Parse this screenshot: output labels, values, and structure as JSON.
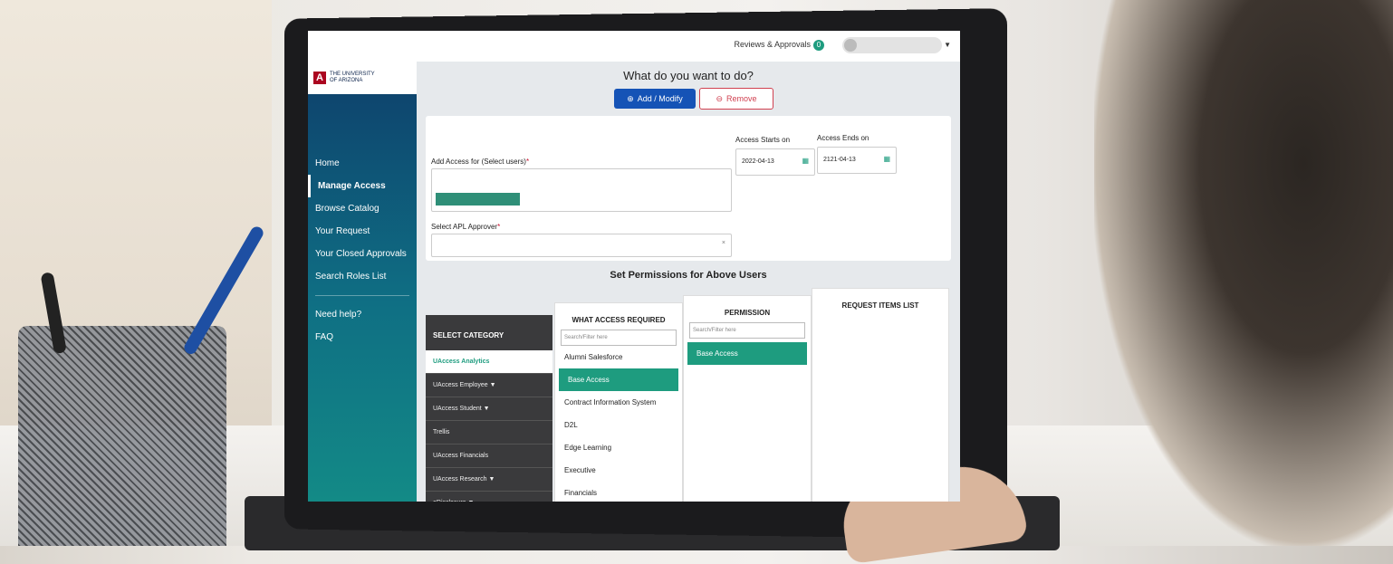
{
  "topbar": {
    "reviews_label": "Reviews & Approvals",
    "reviews_count": "0"
  },
  "logo": {
    "line1": "THE UNIVERSITY",
    "line2": "OF ARIZONA",
    "mark": "A"
  },
  "sidebar": {
    "items": [
      {
        "label": "Home"
      },
      {
        "label": "Manage Access"
      },
      {
        "label": "Browse Catalog"
      },
      {
        "label": "Your Request"
      },
      {
        "label": "Your Closed Approvals"
      },
      {
        "label": "Search Roles List"
      },
      {
        "label": "Need help?"
      },
      {
        "label": "FAQ"
      }
    ]
  },
  "main": {
    "question": "What do you want to do?",
    "add_label": "Add / Modify",
    "remove_label": "Remove",
    "add_access_label": "Add Access for (Select users)",
    "starts_label": "Access Starts on",
    "starts_value": "2022-04-13",
    "ends_label": "Access Ends on",
    "ends_value": "2121-04-13",
    "approver_label": "Select APL Approver",
    "permissions_title": "Set Permissions for Above Users"
  },
  "categories": {
    "header": "SELECT CATEGORY",
    "items": [
      "UAccess Analytics",
      "UAccess Employee",
      "UAccess Student",
      "Trellis",
      "UAccess Financials",
      "UAccess Research",
      "eDisclosure"
    ]
  },
  "access": {
    "header": "WHAT ACCESS REQUIRED",
    "placeholder": "Search/Filter here",
    "items": [
      "Alumni Salesforce",
      "Base Access",
      "Contract Information System",
      "D2L",
      "Edge Learning",
      "Executive",
      "Financials"
    ]
  },
  "permission": {
    "header": "PERMISSION",
    "placeholder": "Search/Filter here",
    "items": [
      "Base Access"
    ]
  },
  "request": {
    "header": "REQUEST ITEMS LIST"
  }
}
